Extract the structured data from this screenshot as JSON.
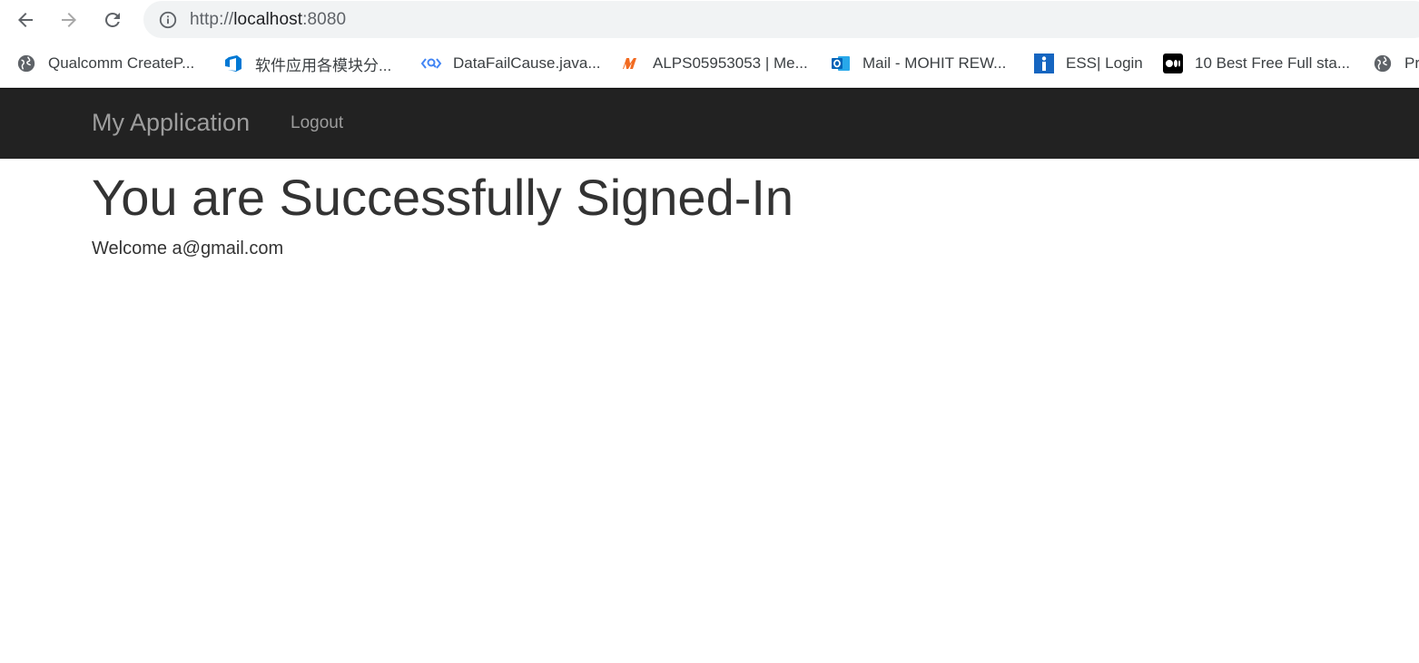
{
  "browser": {
    "url_scheme": "http://",
    "url_host": "localhost",
    "url_port": ":8080"
  },
  "bookmarks": [
    {
      "label": "Qualcomm CreateP...",
      "icon": "globe-icon"
    },
    {
      "label": "软件应用各模块分...",
      "icon": "azure-devops-icon"
    },
    {
      "label": "DataFailCause.java...",
      "icon": "code-search-icon"
    },
    {
      "label": "ALPS05953053 | Me...",
      "icon": "mediatek-icon"
    },
    {
      "label": "Mail - MOHIT REW...",
      "icon": "outlook-icon"
    },
    {
      "label": "ESS| Login",
      "icon": "info-icon"
    },
    {
      "label": "10 Best Free Full sta...",
      "icon": "medium-icon"
    },
    {
      "label": "Pr",
      "icon": "globe-icon"
    }
  ],
  "app": {
    "brand": "My Application",
    "logout_label": "Logout",
    "title": "You are Successfully Signed-In",
    "welcome": "Welcome a@gmail.com"
  },
  "colors": {
    "navbar_bg": "#222222",
    "navbar_text": "#9d9d9d",
    "heading_text": "#333333"
  }
}
